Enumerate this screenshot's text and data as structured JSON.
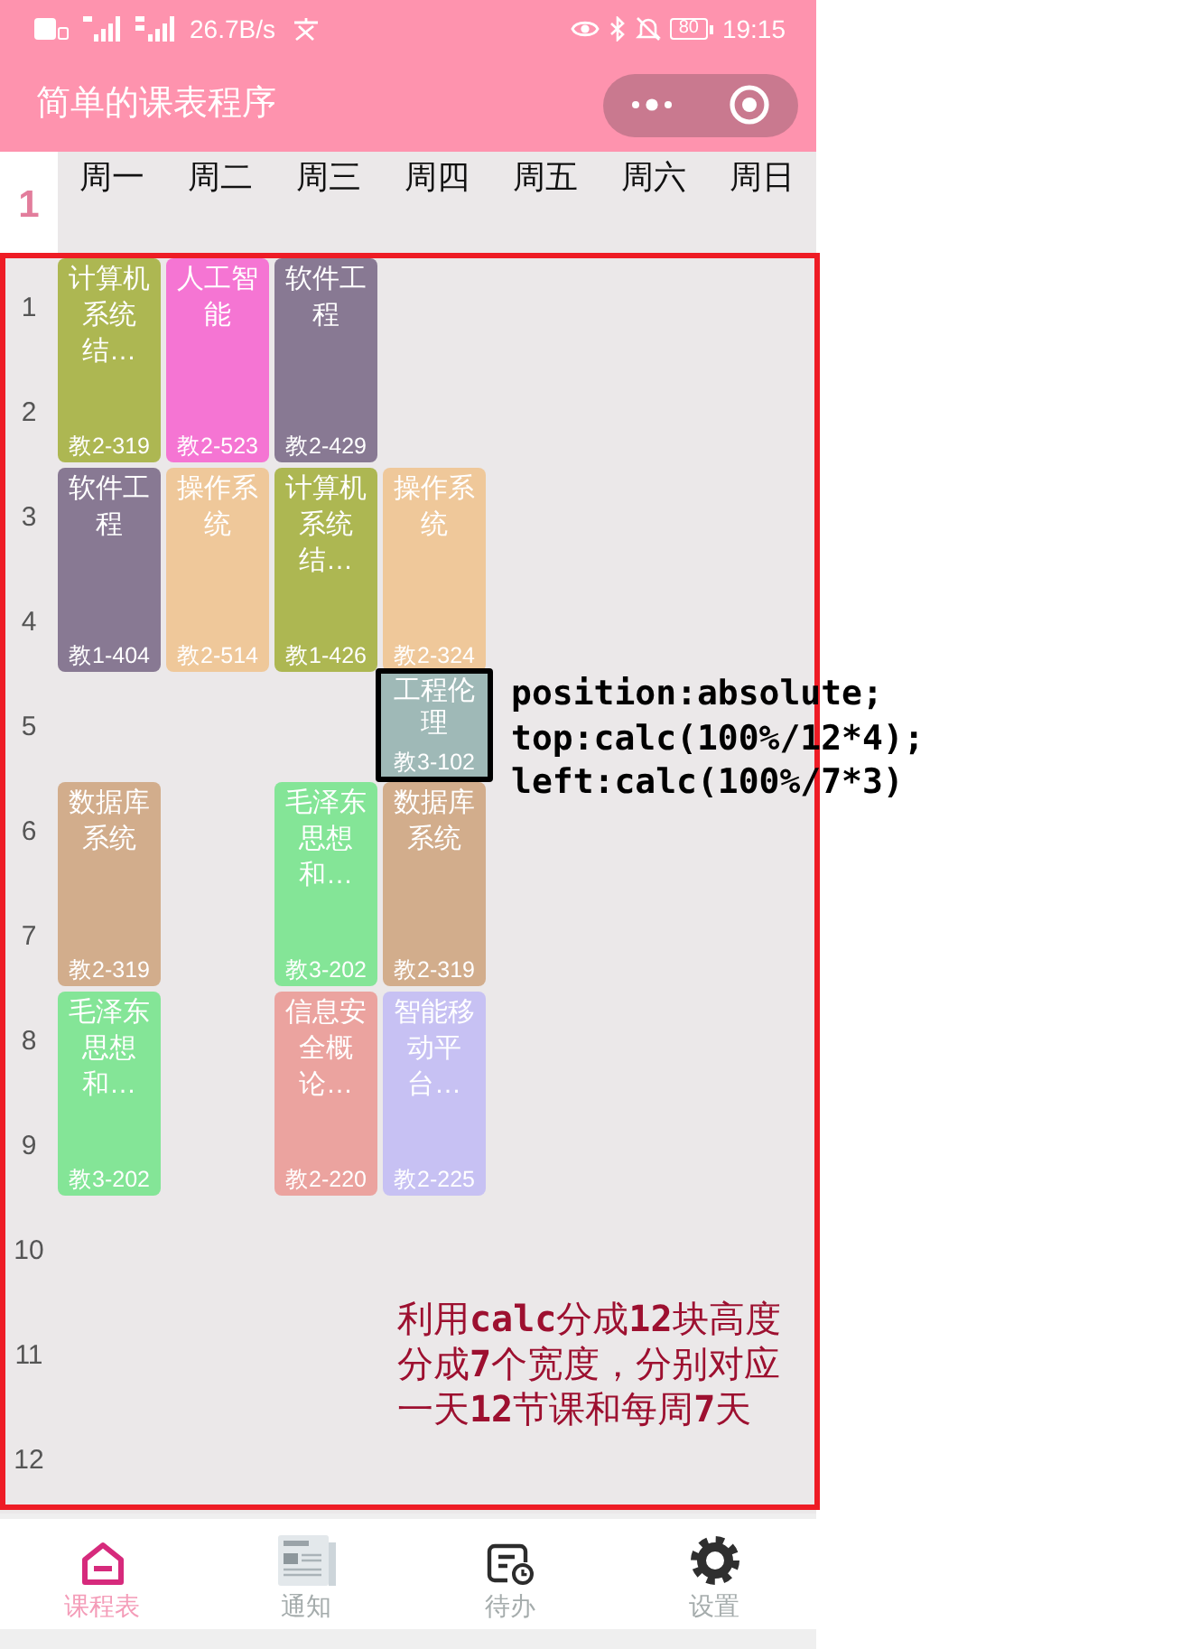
{
  "status_bar": {
    "network_speed": "26.7B/s",
    "battery": "80",
    "time": "19:15"
  },
  "nav_bar": {
    "title": "简单的课表程序"
  },
  "timetable": {
    "week": "1",
    "days": [
      {
        "label": "周一",
        "slots": [
          {
            "kind": "two_periods",
            "name": "计算机系统结…",
            "room": "教2-319",
            "color": "#adb752",
            "outlined": false
          },
          {
            "kind": "two_periods",
            "name": "软件工程",
            "room": "教1-404",
            "color": "#887993",
            "outlined": false
          },
          {
            "kind": "free"
          },
          {
            "kind": "two_periods",
            "name": "数据库系统",
            "room": "教2-319",
            "color": "#d2ad8c",
            "outlined": false
          },
          {
            "kind": "two_periods",
            "name": "毛泽东思想和…",
            "room": "教3-202",
            "color": "#84e597",
            "outlined": false
          }
        ]
      },
      {
        "label": "周二",
        "slots": [
          {
            "kind": "two_periods",
            "name": "人工智能",
            "room": "教2-523",
            "color": "#f575d3",
            "outlined": false
          },
          {
            "kind": "two_periods",
            "name": "操作系统",
            "room": "教2-514",
            "color": "#efc89a",
            "outlined": false
          }
        ]
      },
      {
        "label": "周三",
        "slots": [
          {
            "kind": "two_periods",
            "name": "软件工程",
            "room": "教2-429",
            "color": "#887993",
            "outlined": false
          },
          {
            "kind": "two_periods",
            "name": "计算机系统结…",
            "room": "教1-426",
            "color": "#adb752",
            "outlined": false
          },
          {
            "kind": "free"
          },
          {
            "kind": "two_periods",
            "name": "毛泽东思想和…",
            "room": "教3-202",
            "color": "#84e597",
            "outlined": false
          },
          {
            "kind": "two_periods",
            "name": "信息安全概论…",
            "room": "教2-220",
            "color": "#eba39f",
            "outlined": false
          }
        ]
      },
      {
        "label": "周四",
        "slots": [
          {
            "kind": "free"
          },
          {
            "kind": "free"
          },
          {
            "kind": "two_periods",
            "name": "操作系统",
            "room": "教2-324",
            "color": "#efc89a",
            "outlined": false
          },
          {
            "kind": "one_period",
            "name": "工程伦理",
            "room": "教3-102",
            "color": "#9fb9b7",
            "outlined": true
          },
          {
            "kind": "two_periods",
            "name": "数据库系统",
            "room": "教2-319",
            "color": "#d2ad8c",
            "outlined": false
          },
          {
            "kind": "two_periods",
            "name": "智能移动平台…",
            "room": "教2-225",
            "color": "#c7c1f3",
            "outlined": false
          }
        ]
      },
      {
        "label": "周五"
      },
      {
        "label": "周六"
      },
      {
        "label": "周日"
      }
    ],
    "periods": [
      "1",
      "2",
      "3",
      "4",
      "5",
      "6",
      "7",
      "8",
      "9",
      "10",
      "11",
      "12"
    ]
  },
  "annotations": {
    "code_lines": [
      "position:absolute;",
      "top:calc(100%/12*4);",
      "left:calc(100%/7*3)"
    ],
    "note_lines": [
      "利用**calc**分成**12**块高度",
      "分成**7**个宽度，分别对应",
      "一天**12**节课和每周**7**天"
    ]
  },
  "tab_bar": {
    "tabs": [
      {
        "label": "课程表",
        "selected": true
      },
      {
        "label": "通知",
        "selected": false
      },
      {
        "label": "待办",
        "selected": false
      },
      {
        "label": "设置",
        "selected": false
      }
    ]
  }
}
